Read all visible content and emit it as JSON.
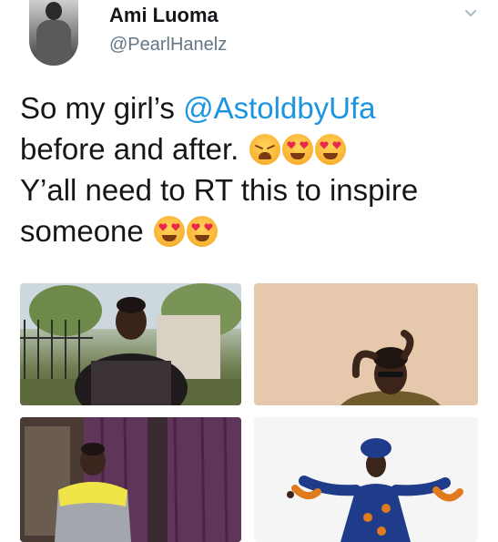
{
  "author": {
    "name": "Ami Luoma",
    "handle": "@PearlHanelz"
  },
  "tweet": {
    "line1_prefix": "So my girl’s ",
    "line1_mention": "@AstoldbyUfa",
    "line2": "before and after.",
    "line3": "Y’all need to RT this to inspire",
    "line4": "someone"
  },
  "icons": {
    "chevron": "chevron-down-icon",
    "emoji_weary": "weary-face-emoji",
    "emoji_heart_eyes": "smiling-face-with-heart-eyes-emoji"
  },
  "colors": {
    "mention": "#1b95e0",
    "handle": "#657786",
    "text": "#14171a"
  }
}
